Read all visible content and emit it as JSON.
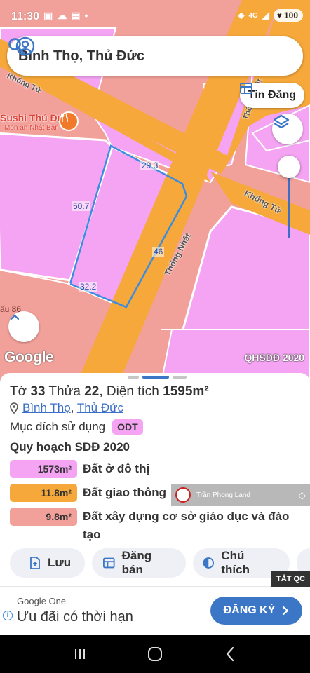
{
  "status_bar": {
    "time": "11:30",
    "network": "4G",
    "battery": "100"
  },
  "search": {
    "location": "Bình Thọ, Thủ Đức"
  },
  "map": {
    "post_button_label": "Tin Đăng",
    "poi": {
      "name": "Sushi Thủ Đức",
      "subtitle": "Món ăn Nhật Bản"
    },
    "edge_labels": [
      "29.3",
      "50.7",
      "46",
      "32.2"
    ],
    "streets": [
      "Thống Nhất",
      "Khổng Tử",
      "Thống Nhất",
      "Khổng Tử"
    ],
    "edge_text": "ấu 86",
    "google_logo": "Google",
    "map_tag": "QHSDĐ 2020"
  },
  "parcel": {
    "sheet_prefix": "Tờ ",
    "sheet_no": "33",
    "parcel_prefix": " Thửa ",
    "parcel_no": "22",
    "area_prefix": ", Diện tích ",
    "area": "1595m²",
    "ward": "Bình Thọ",
    "district": "Thủ Đức",
    "purpose_label": "Mục đích sử dụng",
    "purpose_code": "ODT",
    "plan_title": "Quy hoạch SDĐ 2020",
    "land_uses": [
      {
        "area": "1573m²",
        "name": "Đất ở đô thị",
        "color": "#f4a4f2"
      },
      {
        "area": "11.8m²",
        "name": "Đất giao thông",
        "color": "#f6a83a"
      },
      {
        "area": "9.8m²",
        "name": "Đất xây dựng cơ sở giáo dục và đào tạo",
        "color": "#f2a09a"
      }
    ]
  },
  "watermark": {
    "text": "Trần Phong Land"
  },
  "actions": {
    "save": "Lưu",
    "sell": "Đăng bán",
    "legend": "Chú thích"
  },
  "ad": {
    "close_label": "TẮT QC",
    "brand": "Google One",
    "text": "Ưu đãi có thời hạn",
    "cta": "ĐĂNG KÝ"
  },
  "colors": {
    "residential": "#f4a4f2",
    "road": "#f6a83a",
    "education": "#f2a09a",
    "parcel_outline": "#3b8ce0",
    "accent": "#3c77c7"
  }
}
